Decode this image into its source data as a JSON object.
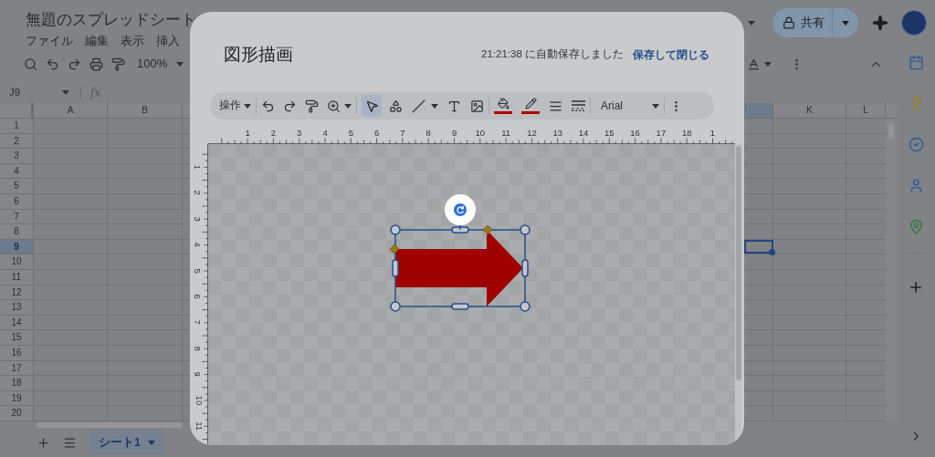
{
  "app": {
    "title": "無題のスプレッドシート",
    "menu": [
      "ファイル",
      "編集",
      "表示",
      "挿入"
    ],
    "zoom": "100%",
    "name_box": "J9",
    "formula_label": "fx",
    "share_button": "共有"
  },
  "sheet": {
    "columns_left": [
      {
        "label": "A",
        "selected": false
      },
      {
        "label": "B",
        "selected": false
      }
    ],
    "partial_column": {
      "selected": true
    },
    "columns_right": [
      {
        "label": "K",
        "selected": false
      },
      {
        "label": "L",
        "selected": false
      }
    ],
    "rows": [
      {
        "label": "1",
        "selected": false
      },
      {
        "label": "2",
        "selected": false
      },
      {
        "label": "3",
        "selected": false
      },
      {
        "label": "4",
        "selected": false
      },
      {
        "label": "5",
        "selected": false
      },
      {
        "label": "6",
        "selected": false
      },
      {
        "label": "7",
        "selected": false
      },
      {
        "label": "8",
        "selected": false
      },
      {
        "label": "9",
        "selected": true
      },
      {
        "label": "10",
        "selected": false
      },
      {
        "label": "11",
        "selected": false
      },
      {
        "label": "12",
        "selected": false
      },
      {
        "label": "13",
        "selected": false
      },
      {
        "label": "14",
        "selected": false
      },
      {
        "label": "15",
        "selected": false
      },
      {
        "label": "16",
        "selected": false
      },
      {
        "label": "17",
        "selected": false
      },
      {
        "label": "18",
        "selected": false
      },
      {
        "label": "19",
        "selected": false
      },
      {
        "label": "20",
        "selected": false
      }
    ]
  },
  "sheet_tabs": [
    {
      "label": "シート1",
      "selected": true
    }
  ],
  "dialog": {
    "title": "図形描画",
    "autosave": "21:21:38 に自動保存しました",
    "save_close": "保存して閉じる",
    "toolbar": {
      "actions_menu": "操作",
      "select_tool": {
        "selected": true
      },
      "color_buttons": [
        {
          "kind": "fill",
          "color": "#b00000"
        },
        {
          "kind": "line",
          "color": "#b00000"
        }
      ],
      "font": "Arial"
    },
    "ruler_horizontal": [
      "1",
      "2",
      "3",
      "4",
      "5",
      "6",
      "7",
      "8",
      "9",
      "10",
      "11",
      "12",
      "13",
      "14",
      "15",
      "16",
      "17",
      "18",
      "1"
    ],
    "ruler_vertical": [
      "1",
      "2",
      "3",
      "4",
      "5",
      "6",
      "7",
      "8",
      "9",
      "10",
      "11"
    ]
  }
}
